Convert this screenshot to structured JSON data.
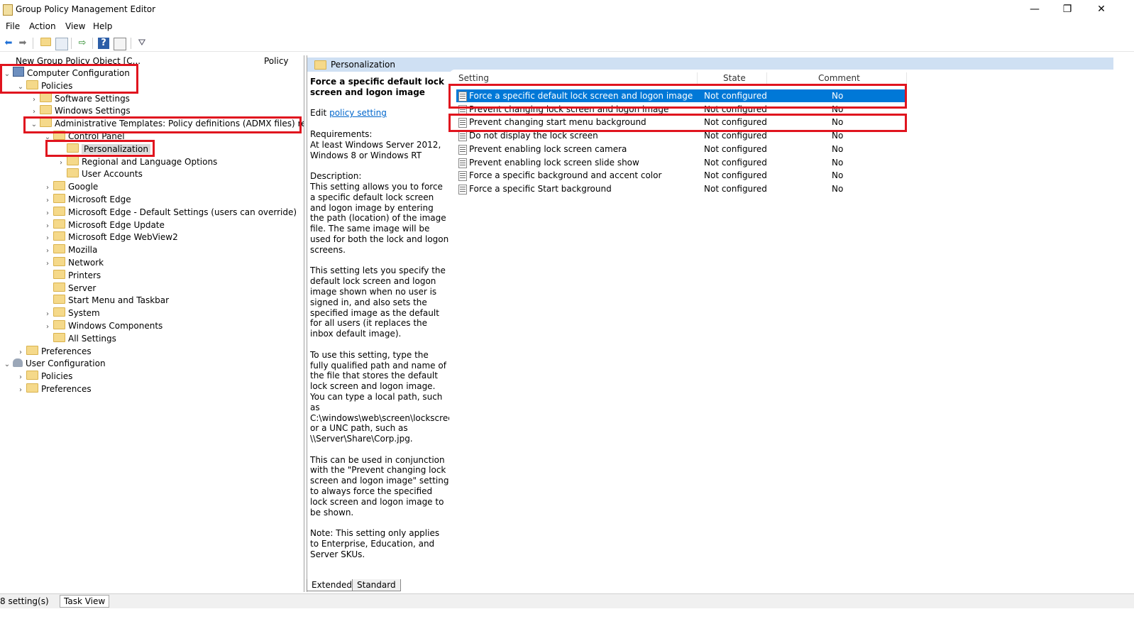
{
  "window": {
    "title": "Group Policy Management Editor",
    "controls": {
      "minimize": "—",
      "maximize": "❐",
      "close": "✕"
    }
  },
  "menu": [
    "File",
    "Action",
    "View",
    "Help"
  ],
  "toolbar": {
    "icons": [
      "back-icon",
      "forward-icon",
      "up-folder-icon",
      "show-hide-tree-icon",
      "export-list-icon",
      "help-icon",
      "properties-icon",
      "filter-icon"
    ]
  },
  "tree": {
    "header": {
      "col1": "New Group Policy Object [C...",
      "col2": "Policy"
    },
    "nodes": [
      {
        "label": "Computer Configuration",
        "level": 0,
        "expander": "down",
        "icon": "computer"
      },
      {
        "label": "Policies",
        "level": 1,
        "expander": "down",
        "icon": "folder"
      },
      {
        "label": "Software Settings",
        "level": 2,
        "expander": "right",
        "icon": "folder"
      },
      {
        "label": "Windows Settings",
        "level": 2,
        "expander": "right",
        "icon": "folder"
      },
      {
        "label": "Administrative Templates: Policy definitions (ADMX files) retrieved",
        "level": 2,
        "expander": "down",
        "icon": "folder"
      },
      {
        "label": "Control Panel",
        "level": 3,
        "expander": "down",
        "icon": "folder"
      },
      {
        "label": "Personalization",
        "level": 4,
        "expander": "",
        "icon": "folder",
        "selected": true
      },
      {
        "label": "Regional and Language Options",
        "level": 4,
        "expander": "right",
        "icon": "folder"
      },
      {
        "label": "User Accounts",
        "level": 4,
        "expander": "",
        "icon": "folder"
      },
      {
        "label": "Google",
        "level": 3,
        "expander": "right",
        "icon": "folder"
      },
      {
        "label": "Microsoft Edge",
        "level": 3,
        "expander": "right",
        "icon": "folder"
      },
      {
        "label": "Microsoft Edge - Default Settings (users can override)",
        "level": 3,
        "expander": "right",
        "icon": "folder"
      },
      {
        "label": "Microsoft Edge Update",
        "level": 3,
        "expander": "right",
        "icon": "folder"
      },
      {
        "label": "Microsoft Edge WebView2",
        "level": 3,
        "expander": "right",
        "icon": "folder"
      },
      {
        "label": "Mozilla",
        "level": 3,
        "expander": "right",
        "icon": "folder"
      },
      {
        "label": "Network",
        "level": 3,
        "expander": "right",
        "icon": "folder"
      },
      {
        "label": "Printers",
        "level": 3,
        "expander": "",
        "icon": "folder"
      },
      {
        "label": "Server",
        "level": 3,
        "expander": "",
        "icon": "folder"
      },
      {
        "label": "Start Menu and Taskbar",
        "level": 3,
        "expander": "",
        "icon": "folder"
      },
      {
        "label": "System",
        "level": 3,
        "expander": "right",
        "icon": "folder"
      },
      {
        "label": "Windows Components",
        "level": 3,
        "expander": "right",
        "icon": "folder"
      },
      {
        "label": "All Settings",
        "level": 3,
        "expander": "",
        "icon": "folder"
      },
      {
        "label": "Preferences",
        "level": 1,
        "expander": "right",
        "icon": "folder"
      },
      {
        "label": "User Configuration",
        "level": 0,
        "expander": "down",
        "icon": "user"
      },
      {
        "label": "Policies",
        "level": 1,
        "expander": "right",
        "icon": "folder"
      },
      {
        "label": "Preferences",
        "level": 1,
        "expander": "right",
        "icon": "folder"
      }
    ]
  },
  "right": {
    "header": "Personalization",
    "description": {
      "title": "Force a specific default lock screen and logon image",
      "edit_prefix": "Edit",
      "edit_link": "policy setting",
      "requirements": "Requirements:\nAt least Windows Server 2012, Windows 8 or Windows RT",
      "paragraphs": [
        "Description:\nThis setting allows you to force a specific default lock screen and logon image by entering the path (location) of the image file. The same image will be used for both the lock and logon screens.",
        "This setting lets you specify the default lock screen and logon image shown when no user is signed in, and also sets the specified image as the default for all users (it replaces the inbox default image).",
        "To use this setting, type the fully qualified path and name of the file that stores the default lock screen and logon image. You can type a local path, such as C:\\windows\\web\\screen\\lockscreen.jpg or a UNC path, such as \\\\Server\\Share\\Corp.jpg.",
        "This can be used in conjunction with the \"Prevent changing lock screen and logon image\" setting to always force the specified lock screen and logon image to be shown.",
        "Note: This setting only applies to Enterprise, Education, and Server SKUs."
      ]
    },
    "columns": [
      "Setting",
      "State",
      "Comment"
    ],
    "rows": [
      {
        "setting": "Force a specific default lock screen and logon image",
        "state": "Not configured",
        "comment": "No",
        "selected": true
      },
      {
        "setting": "Prevent changing lock screen and logon image",
        "state": "Not configured",
        "comment": "No"
      },
      {
        "setting": "Prevent changing start menu background",
        "state": "Not configured",
        "comment": "No"
      },
      {
        "setting": "Do not display the lock screen",
        "state": "Not configured",
        "comment": "No"
      },
      {
        "setting": "Prevent enabling lock screen camera",
        "state": "Not configured",
        "comment": "No"
      },
      {
        "setting": "Prevent enabling lock screen slide show",
        "state": "Not configured",
        "comment": "No"
      },
      {
        "setting": "Force a specific background and accent color",
        "state": "Not configured",
        "comment": "No"
      },
      {
        "setting": "Force a specific Start background",
        "state": "Not configured",
        "comment": "No"
      }
    ],
    "tabs": [
      "Extended",
      "Standard"
    ]
  },
  "status": {
    "count": "8 setting(s)",
    "task_view": "Task View"
  },
  "colors": {
    "highlight": "#e0141e",
    "selection": "#0078d7",
    "header": "#cfe0f3"
  }
}
